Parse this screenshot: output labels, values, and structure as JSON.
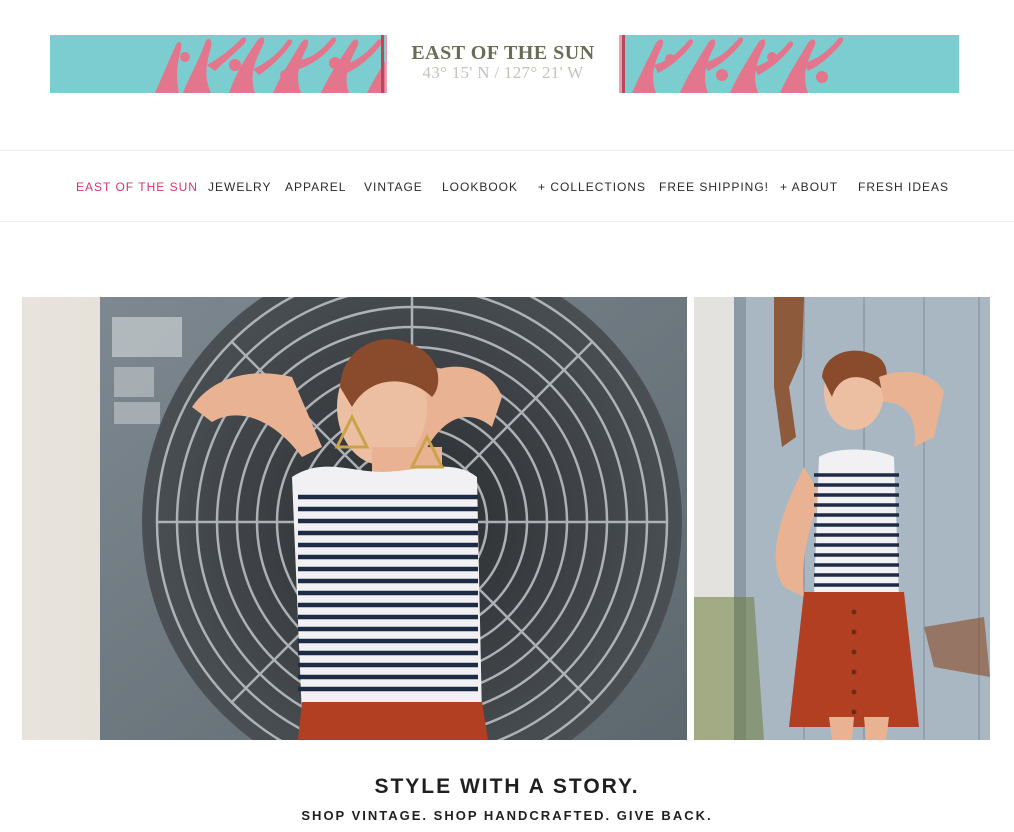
{
  "banner": {
    "title": "EAST OF THE SUN",
    "coordinates": "43° 15' N / 127° 21' W",
    "background_color": "#7ccdd0",
    "accent_color": "#ec6e87"
  },
  "nav": {
    "items": [
      {
        "label": "EAST OF THE SUN",
        "active": true
      },
      {
        "label": "JEWELRY"
      },
      {
        "label": "APPAREL"
      },
      {
        "label": "VINTAGE"
      },
      {
        "label": "LOOKBOOK"
      },
      {
        "label": "+ COLLECTIONS"
      },
      {
        "label": "FREE SHIPPING!"
      },
      {
        "label": "+ ABOUT"
      },
      {
        "label": "FRESH IDEAS"
      }
    ],
    "active_color": "#d6336c"
  },
  "hero": {
    "tagline": "STYLE WITH A STORY.",
    "subtagline": "SHOP VINTAGE. SHOP HANDCRAFTED. GIVE BACK."
  }
}
